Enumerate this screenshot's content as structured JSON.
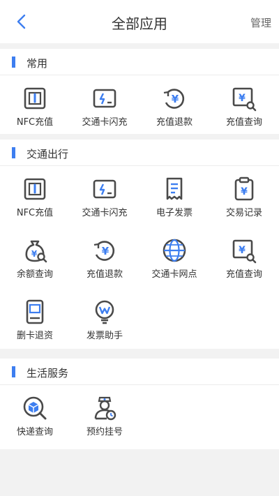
{
  "header": {
    "title": "全部应用",
    "manage_label": "管理"
  },
  "icons": {
    "back": "chevron-left-icon"
  },
  "colors": {
    "accent": "#3d7ef0",
    "icon_dark": "#4a4a4a",
    "bg": "#f2f2f2"
  },
  "sections": [
    {
      "title": "常用",
      "items": [
        {
          "label": "NFC充值",
          "icon": "nfc-card-icon"
        },
        {
          "label": "交通卡闪充",
          "icon": "flash-charge-icon"
        },
        {
          "label": "充值退款",
          "icon": "refund-icon"
        },
        {
          "label": "充值查询",
          "icon": "recharge-search-icon"
        }
      ]
    },
    {
      "title": "交通出行",
      "items": [
        {
          "label": "NFC充值",
          "icon": "nfc-card-icon"
        },
        {
          "label": "交通卡闪充",
          "icon": "flash-charge-icon"
        },
        {
          "label": "电子发票",
          "icon": "receipt-icon"
        },
        {
          "label": "交易记录",
          "icon": "clipboard-icon"
        },
        {
          "label": "余额查询",
          "icon": "money-bag-icon"
        },
        {
          "label": "充值退款",
          "icon": "refund-icon"
        },
        {
          "label": "交通卡网点",
          "icon": "globe-icon"
        },
        {
          "label": "充值查询",
          "icon": "recharge-search-icon"
        },
        {
          "label": "删卡退资",
          "icon": "device-card-icon"
        },
        {
          "label": "发票助手",
          "icon": "bulb-icon"
        }
      ]
    },
    {
      "title": "生活服务",
      "items": [
        {
          "label": "快递查询",
          "icon": "parcel-search-icon"
        },
        {
          "label": "预约挂号",
          "icon": "doctor-icon"
        }
      ]
    }
  ]
}
